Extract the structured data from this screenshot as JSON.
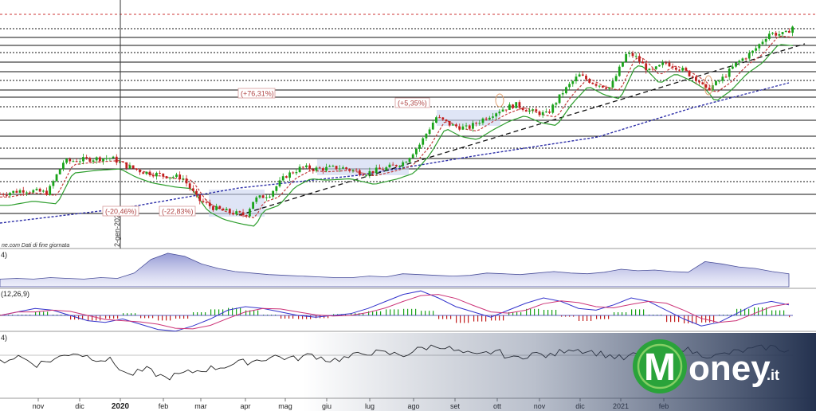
{
  "chart_data": {
    "type": "candlestick",
    "x_ticks": [
      "nov",
      "dic",
      "2020",
      "feb",
      "mar",
      "apr",
      "mag",
      "giu",
      "lug",
      "ago",
      "set",
      "ott",
      "nov",
      "dic",
      "2021",
      "feb"
    ],
    "date_marker": "2-gen-2020",
    "source_note": "ne.com  Dati di fine giornata",
    "annotations": [
      {
        "text": "(+76,31%)"
      },
      {
        "text": "(+5,35%)"
      },
      {
        "text": "(-20,46%)"
      },
      {
        "text": "(-22,83%)"
      }
    ],
    "price_series": [
      {
        "t": 0,
        "v": 32
      },
      {
        "t": 3,
        "v": 35
      },
      {
        "t": 6,
        "v": 33
      },
      {
        "t": 8,
        "v": 55
      },
      {
        "t": 11,
        "v": 57
      },
      {
        "t": 14,
        "v": 58
      },
      {
        "t": 16,
        "v": 52
      },
      {
        "t": 18,
        "v": 48
      },
      {
        "t": 21,
        "v": 45
      },
      {
        "t": 23,
        "v": 44
      },
      {
        "t": 25,
        "v": 28
      },
      {
        "t": 27,
        "v": 22
      },
      {
        "t": 29,
        "v": 19
      },
      {
        "t": 31,
        "v": 17
      },
      {
        "t": 32,
        "v": 28
      },
      {
        "t": 34,
        "v": 32
      },
      {
        "t": 36,
        "v": 45
      },
      {
        "t": 38,
        "v": 51
      },
      {
        "t": 40,
        "v": 50
      },
      {
        "t": 43,
        "v": 51
      },
      {
        "t": 46,
        "v": 47
      },
      {
        "t": 49,
        "v": 51
      },
      {
        "t": 51,
        "v": 55
      },
      {
        "t": 53,
        "v": 68
      },
      {
        "t": 55,
        "v": 87
      },
      {
        "t": 57,
        "v": 81
      },
      {
        "t": 59,
        "v": 79
      },
      {
        "t": 61,
        "v": 86
      },
      {
        "t": 63,
        "v": 92
      },
      {
        "t": 65,
        "v": 96
      },
      {
        "t": 67,
        "v": 91
      },
      {
        "t": 69,
        "v": 89
      },
      {
        "t": 71,
        "v": 105
      },
      {
        "t": 73,
        "v": 117
      },
      {
        "t": 75,
        "v": 111
      },
      {
        "t": 77,
        "v": 108
      },
      {
        "t": 79,
        "v": 132
      },
      {
        "t": 80,
        "v": 131
      },
      {
        "t": 82,
        "v": 119
      },
      {
        "t": 84,
        "v": 126
      },
      {
        "t": 86,
        "v": 121
      },
      {
        "t": 88,
        "v": 114
      },
      {
        "t": 89,
        "v": 106
      },
      {
        "t": 91,
        "v": 114
      },
      {
        "t": 93,
        "v": 126
      },
      {
        "t": 95,
        "v": 134
      },
      {
        "t": 97,
        "v": 147
      },
      {
        "t": 99,
        "v": 146
      },
      {
        "t": 100,
        "v": 152
      }
    ],
    "volume_series": [
      10,
      11,
      10,
      12,
      11,
      10,
      12,
      11,
      18,
      36,
      44,
      40,
      30,
      24,
      20,
      18,
      16,
      15,
      14,
      13,
      12,
      12,
      14,
      13,
      17,
      16,
      15,
      14,
      15,
      18,
      17,
      16,
      18,
      20,
      18,
      17,
      19,
      23,
      21,
      22,
      20,
      19,
      33,
      30,
      26,
      24,
      20,
      17
    ],
    "macd_series": [
      0,
      2,
      4,
      3,
      0,
      -3,
      -4,
      -2,
      -5,
      -8,
      -9,
      -6,
      -2,
      3,
      5,
      4,
      2,
      0,
      -1,
      0,
      1,
      4,
      8,
      12,
      14,
      10,
      5,
      2,
      -1,
      3,
      7,
      10,
      8,
      4,
      3,
      6,
      10,
      8,
      3,
      -2,
      -6,
      -4,
      1,
      6,
      8,
      6
    ],
    "rs_series": [
      20,
      24,
      18,
      22,
      27,
      23,
      21,
      10,
      14,
      8,
      11,
      14,
      16,
      19,
      21,
      24,
      22,
      25,
      21,
      23,
      27,
      26,
      25,
      30,
      32,
      27,
      24,
      28,
      22,
      26,
      24,
      30,
      28,
      25,
      22,
      27,
      30,
      31,
      26,
      24,
      27,
      29,
      31,
      28
    ]
  },
  "indicator_labels": {
    "volume": "4)",
    "macd": "(12,26,9)",
    "rs": "4)"
  },
  "colors": {
    "up": "#1aa31a",
    "down": "#c21f1f",
    "ma_green": "#2e9e2e",
    "ma_red": "#c23b3b",
    "long_ma": "#2d2fa8",
    "volume_fill": "#a9addc",
    "macd_blue": "#3333cc",
    "macd_pink": "#cc3377",
    "bg_dark": "#2e3e60"
  },
  "logo": {
    "letter": "M",
    "text": "oney",
    "suffix": ".it"
  }
}
